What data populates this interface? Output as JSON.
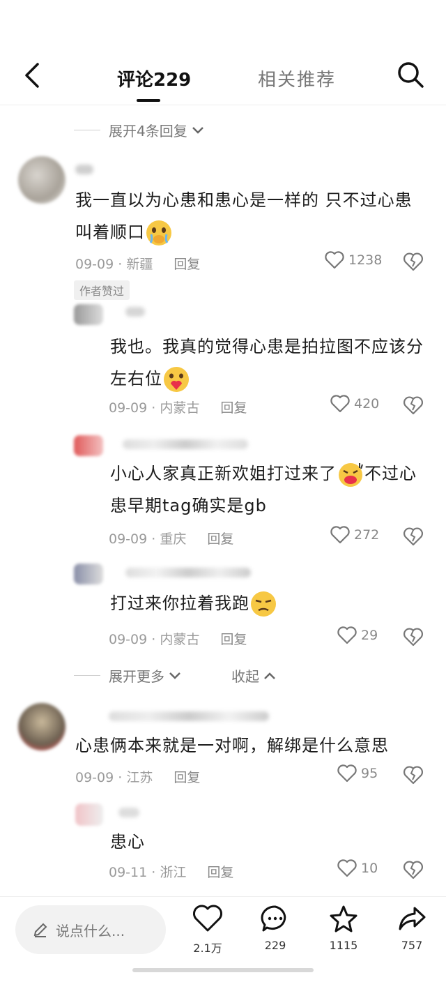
{
  "header": {
    "tab_comments": "评论229",
    "tab_related": "相关推荐"
  },
  "expand_top": "展开4条回复",
  "comments": [
    {
      "text": "我一直以为心患和患心是一样的 只不过心患叫着顺口",
      "date": "09-09",
      "location": "新疆",
      "reply": "回复",
      "likes": "1238",
      "badge": "作者赞过"
    },
    {
      "text": "我也。我真的觉得心患是拍拉图不应该分左右位",
      "date": "09-09",
      "location": "内蒙古",
      "reply": "回复",
      "likes": "420"
    },
    {
      "text": "小心人家真正新欢姐打过来了",
      "text_after": "不过心患早期tag确实是gb",
      "date": "09-09",
      "location": "重庆",
      "reply": "回复",
      "likes": "272"
    },
    {
      "text": "打过来你拉着我跑",
      "date": "09-09",
      "location": "内蒙古",
      "reply": "回复",
      "likes": "29"
    },
    {
      "text": "心患俩本来就是一对啊，解绑是什么意思",
      "date": "09-09",
      "location": "江苏",
      "reply": "回复",
      "likes": "95"
    },
    {
      "text": "患心",
      "date": "09-11",
      "location": "浙江",
      "reply": "回复",
      "likes": "10"
    }
  ],
  "expand_more": "展开更多",
  "collapse": "收起",
  "bottom": {
    "input_placeholder": "说点什么...",
    "likes": "2.1万",
    "comments": "229",
    "favorites": "1115",
    "shares": "757"
  },
  "colors": {
    "text": "#1c1c1c",
    "meta": "#9a9a9a",
    "divider": "#ececec"
  }
}
